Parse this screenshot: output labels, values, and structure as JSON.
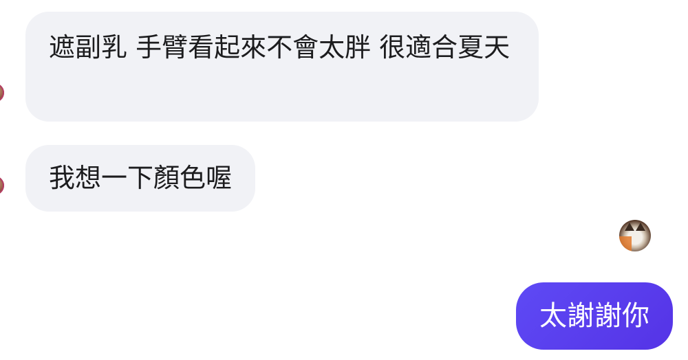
{
  "conversation": {
    "messages": [
      {
        "direction": "incoming",
        "text": "遮副乳 手臂看起來不會太胖 很適合夏天"
      },
      {
        "direction": "incoming",
        "text": "我想一下顏色喔"
      },
      {
        "direction": "outgoing",
        "text": "太謝謝你"
      }
    ]
  },
  "avatars": {
    "peer_icon": "user-avatar",
    "seen_icon": "cat-avatar"
  },
  "colors": {
    "incoming_bubble": "#f1f2f6",
    "outgoing_bubble": "#5b3cf0",
    "background": "#ffffff"
  }
}
